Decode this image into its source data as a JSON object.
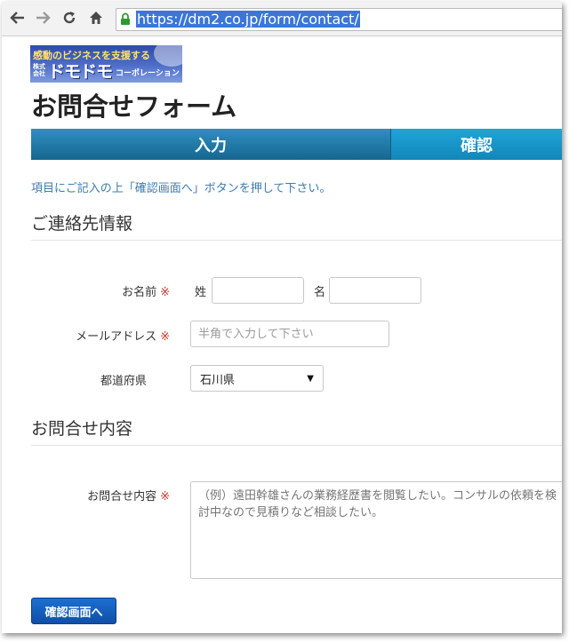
{
  "browser": {
    "url": "https://dm2.co.jp/form/contact/",
    "icons": [
      "back-icon",
      "forward-icon",
      "reload-icon",
      "home-icon",
      "lock-icon"
    ]
  },
  "logo": {
    "tagline": "感動のビジネスを支援する",
    "kabushiki": "株式会社",
    "name": "ドモドモ",
    "suffix": "コーポレーション"
  },
  "page": {
    "title": "お問合せフォーム",
    "steps": [
      "入力",
      "確認"
    ],
    "intro": "項目にご記入の上「確認画面へ」ボタンを押して下さい。"
  },
  "contact_section": {
    "heading": "ご連絡先情報",
    "name_label": "お名前",
    "required_mark": "※",
    "last_name_label": "姓",
    "first_name_label": "名",
    "last_name_value": "",
    "first_name_value": "",
    "email_label": "メールアドレス",
    "email_placeholder": "半角で入力して下さい",
    "pref_label": "都道府県",
    "pref_value": "石川県"
  },
  "inquiry_section": {
    "heading": "お問合せ内容",
    "content_label": "お問合せ内容",
    "content_placeholder": "（例）遠田幹雄さんの業務経歴書を閲覧したい。コンサルの依頼を検討中なので見積りなど相談したい。"
  },
  "submit_label": "確認画面へ",
  "colors": {
    "step_active": "#17668f",
    "step_inactive": "#1fa5d8",
    "button": "#0f4fa8",
    "required": "#c0392b",
    "intro_text": "#3d7bb0"
  }
}
